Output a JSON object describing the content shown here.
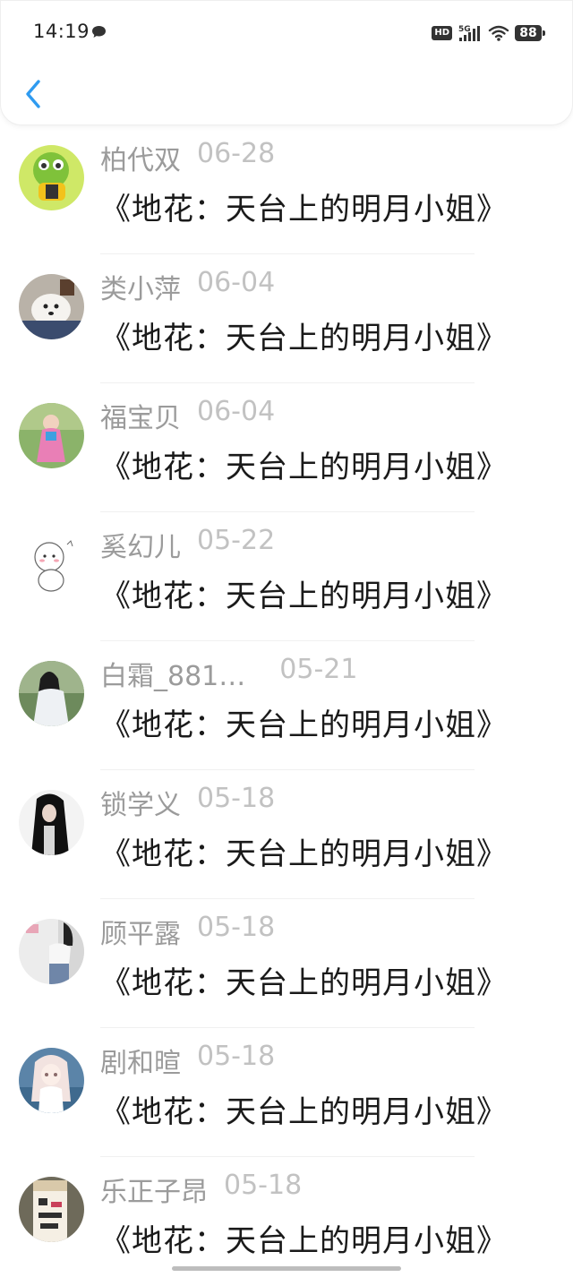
{
  "status_bar": {
    "time": "14:19",
    "hd": "HD",
    "network": "5G",
    "battery": "88"
  },
  "colors": {
    "accent": "#2f9bf0",
    "name_text": "#9b9b9b",
    "date_text": "#c2c2c2",
    "title_text": "#1a1a1a"
  },
  "icons": {
    "back": "chevron-left-icon",
    "message": "chat-bubble-icon",
    "signal": "signal-icon",
    "wifi": "wifi-icon",
    "battery": "battery-icon"
  },
  "list": [
    {
      "name": "柏代双",
      "date": "06-28",
      "title": "《地花：天台上的明月小姐》"
    },
    {
      "name": "类小萍",
      "date": "06-04",
      "title": "《地花：天台上的明月小姐》"
    },
    {
      "name": "福宝贝",
      "date": "06-04",
      "title": "《地花：天台上的明月小姐》"
    },
    {
      "name": "奚幻儿",
      "date": "05-22",
      "title": "《地花：天台上的明月小姐》"
    },
    {
      "name": "白霜_881…",
      "date": "05-21",
      "title": "《地花：天台上的明月小姐》"
    },
    {
      "name": "锁学义",
      "date": "05-18",
      "title": "《地花：天台上的明月小姐》"
    },
    {
      "name": "顾平露",
      "date": "05-18",
      "title": "《地花：天台上的明月小姐》"
    },
    {
      "name": "剧和暄",
      "date": "05-18",
      "title": "《地花：天台上的明月小姐》"
    },
    {
      "name": "乐正子昂",
      "date": "05-18",
      "title": "《地花：天台上的明月小姐》"
    }
  ]
}
